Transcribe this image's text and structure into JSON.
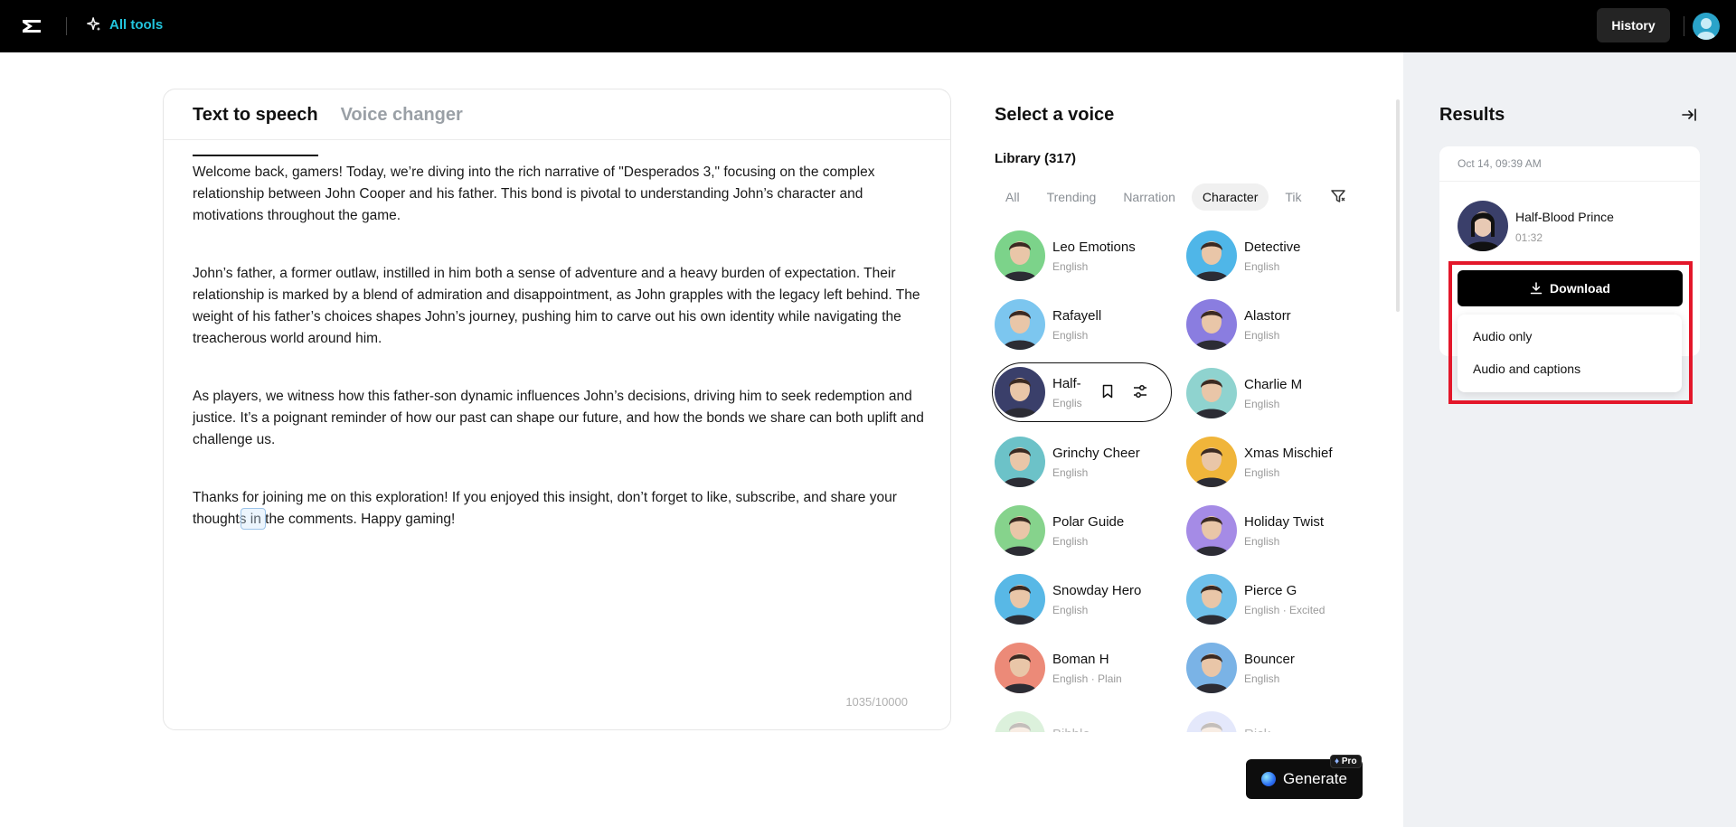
{
  "topbar": {
    "all_tools_label": "All tools",
    "history_label": "History"
  },
  "editor": {
    "tabs": [
      {
        "label": "Text to speech",
        "active": true
      },
      {
        "label": "Voice changer",
        "active": false
      }
    ],
    "paragraphs": [
      "Welcome back, gamers! Today, we’re diving into the rich narrative of \"Desperados 3,\" focusing on the complex relationship between John Cooper and his father. This bond is pivotal to understanding John’s character and motivations throughout the game.",
      "John’s father, a former outlaw, instilled in him both a sense of adventure and a heavy burden of expectation. Their relationship is marked by a blend of admiration and disappointment, as John grapples with the legacy left behind. The weight of his father’s choices shapes John’s journey, pushing him to carve out his own identity while navigating the treacherous world around him.",
      "As players, we witness how this father-son dynamic influences John’s decisions, driving him to seek redemption and justice. It’s a poignant reminder of how our past can shape our future, and how the bonds we share can both uplift and challenge us.",
      "Thanks for joining me on this exploration! If you enjoyed this insight, don’t forget to like, subscribe, and share your thoughts in the comments. Happy gaming!"
    ],
    "char_count": "1035/10000"
  },
  "voice_panel": {
    "title": "Select a voice",
    "library_label": "Library (317)",
    "chips": [
      {
        "label": "All",
        "active": false
      },
      {
        "label": "Trending",
        "active": false
      },
      {
        "label": "Narration",
        "active": false
      },
      {
        "label": "Character",
        "active": true
      },
      {
        "label": "Tik",
        "active": false
      }
    ],
    "voices": [
      {
        "name": "Leo Emotions",
        "lang": "English",
        "color": "#7cd38a"
      },
      {
        "name": "Detective",
        "lang": "English",
        "color": "#4fb6e8"
      },
      {
        "name": "Rafayell",
        "lang": "English",
        "color": "#7cc6ef"
      },
      {
        "name": "Alastorr",
        "lang": "English",
        "color": "#8a7de0"
      },
      {
        "name": "Half-",
        "lang": "Englis",
        "color": "#3a3f6a",
        "selected": true
      },
      {
        "name": "Charlie M",
        "lang": "English",
        "color": "#8fd3cf"
      },
      {
        "name": "Grinchy Cheer",
        "lang": "English",
        "color": "#6cc2c8"
      },
      {
        "name": "Xmas Mischief",
        "lang": "English",
        "color": "#f0b53a"
      },
      {
        "name": "Polar Guide",
        "lang": "English",
        "color": "#86d38c"
      },
      {
        "name": "Holiday Twist",
        "lang": "English",
        "color": "#a58be6"
      },
      {
        "name": "Snowday Hero",
        "lang": "English",
        "color": "#58b8e6"
      },
      {
        "name": "Pierce G",
        "lang": "English · Excited",
        "color": "#6fc0ea"
      },
      {
        "name": "Boman H",
        "lang": "English · Plain",
        "color": "#ec8a78"
      },
      {
        "name": "Bouncer",
        "lang": "English",
        "color": "#7ab3e6"
      },
      {
        "name": "Bibble",
        "lang": "",
        "color": "#8fd38f"
      },
      {
        "name": "Rick",
        "lang": "",
        "color": "#a8b6f2"
      }
    ]
  },
  "generate": {
    "label": "Generate",
    "badge": "Pro"
  },
  "results": {
    "title": "Results",
    "date": "Oct 14, 09:39 AM",
    "voice_name": "Half-Blood Prince",
    "duration": "01:32",
    "download_label": "Download",
    "menu": [
      "Audio only",
      "Audio and captions"
    ]
  },
  "colors": {
    "accent": "#22c4dd",
    "highlight": "#e3172a"
  }
}
